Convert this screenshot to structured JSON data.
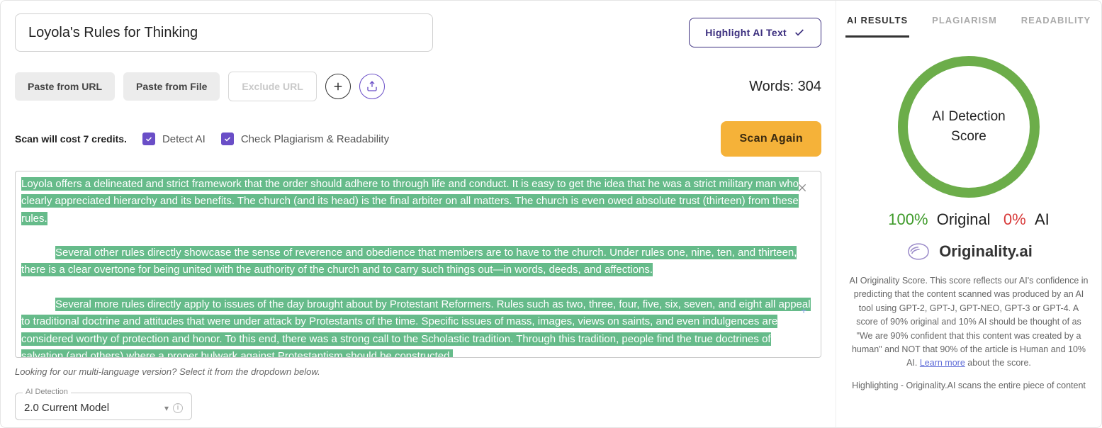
{
  "title_input": {
    "value": "Loyola's Rules for Thinking"
  },
  "highlight_btn": "Highlight AI Text",
  "toolbar": {
    "paste_url": "Paste from URL",
    "paste_file": "Paste from File",
    "exclude_url": "Exclude URL"
  },
  "words": {
    "label": "Words:",
    "count": "304"
  },
  "scan_cost": "Scan will cost 7 credits.",
  "options": {
    "detect_ai": "Detect AI",
    "check_plag": "Check Plagiarism & Readability"
  },
  "scan_again": "Scan Again",
  "content": {
    "p1": "Loyola offers a delineated and strict framework that the order should adhere to through life and conduct. It is easy to get the idea that he was a strict military man who clearly appreciated hierarchy and its benefits. The church (and its head) is the final arbiter on all matters. The church is even owed absolute trust (thirteen) from these rules.",
    "p2": "Several other rules directly showcase the sense of reverence and obedience that members are to have to the church. Under rules one, nine, ten, and thirteen, there is a clear overtone for being united with the authority of the church and to carry such things out—in words, deeds, and affections.",
    "p3": "Several more rules directly apply to issues of the day brought about by Protestant Reformers. Rules such as two, three, four, five, six, seven, and eight all appeal to traditional doctrine and attitudes that were under attack by Protestants of the time. Specific issues of mass, images, views on saints, and even indulgences are considered worthy of protection and honor. To this end, there was a strong call to the Scholastic tradition. Through this tradition, people find the true doctrines of salvation (and others) where a proper bulwark against Protestantism should be constructed."
  },
  "lang_note": "Looking for our multi-language version? Select it from the dropdown below.",
  "model_select": {
    "label": "AI Detection",
    "value": "2.0 Current Model"
  },
  "right": {
    "tabs": {
      "ai": "AI RESULTS",
      "plag": "PLAGIARISM",
      "read": "READABILITY"
    },
    "ring_label_1": "AI Detection",
    "ring_label_2": "Score",
    "score_original_pct": "100%",
    "score_original_label": "Original",
    "score_ai_pct": "0%",
    "score_ai_label": "AI",
    "brand": "Originality.ai",
    "desc_pre": "AI Originality Score. This score reflects our AI's confidence in predicting that the content scanned was produced by an AI tool using GPT-2, GPT-J, GPT-NEO, GPT-3 or GPT-4. A score of 90% original and 10% AI should be thought of as \"We are 90% confident that this content was created by a human\" and NOT that 90% of the article is Human and 10% AI. ",
    "desc_link": "Learn more",
    "desc_post": " about the score.",
    "desc2": "Highlighting - Originality.AI scans the entire piece of content"
  }
}
